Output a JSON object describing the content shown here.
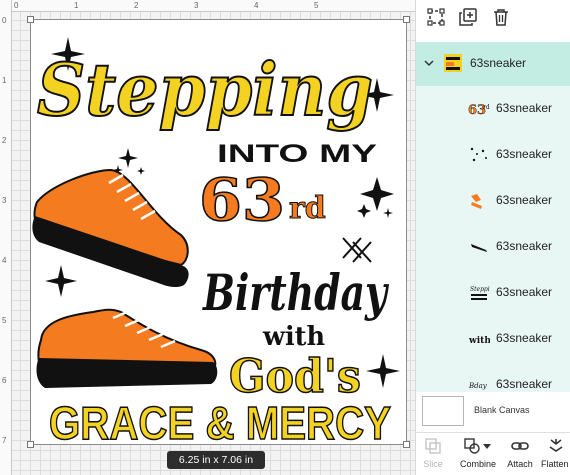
{
  "canvas": {
    "ruler_top_numbers": [
      "0",
      "1",
      "2",
      "3",
      "4",
      "5"
    ],
    "ruler_left_numbers": [
      "0",
      "1",
      "2",
      "3",
      "4",
      "5",
      "6",
      "7"
    ],
    "size_badge": "6.25  in x 7.06  in",
    "design": {
      "title_script": "Stepping",
      "line_into": "INTO MY",
      "age_number": "63",
      "age_suffix": "rd",
      "birthday": "Birthday",
      "with": "with",
      "gods": "God's",
      "grace_mercy": "GRACE & MERCY",
      "colors": {
        "yellow": "#f4d221",
        "orange": "#f47b20",
        "black": "#111111",
        "white": "#ffffff"
      }
    }
  },
  "layers": {
    "toolbar_icons": [
      "ungroup-icon",
      "duplicate-icon",
      "delete-icon"
    ],
    "group": {
      "name": "63sneaker",
      "expanded": true
    },
    "children": [
      {
        "name": "63sneaker",
        "thumb": "63rd"
      },
      {
        "name": "63sneaker",
        "thumb": "stars"
      },
      {
        "name": "63sneaker",
        "thumb": "sneaker-orange"
      },
      {
        "name": "63sneaker",
        "thumb": "laces"
      },
      {
        "name": "63sneaker",
        "thumb": "stepping-text"
      },
      {
        "name": "63sneaker",
        "thumb": "with"
      },
      {
        "name": "63sneaker",
        "thumb": "birthday-text"
      }
    ],
    "blank_canvas_label": "Blank Canvas",
    "accent": "#c3ede3",
    "list_bg": "#e9f7f4"
  },
  "bottom_bar": {
    "slice": "Slice",
    "combine": "Combine",
    "attach": "Attach",
    "flatten": "Flatten"
  }
}
